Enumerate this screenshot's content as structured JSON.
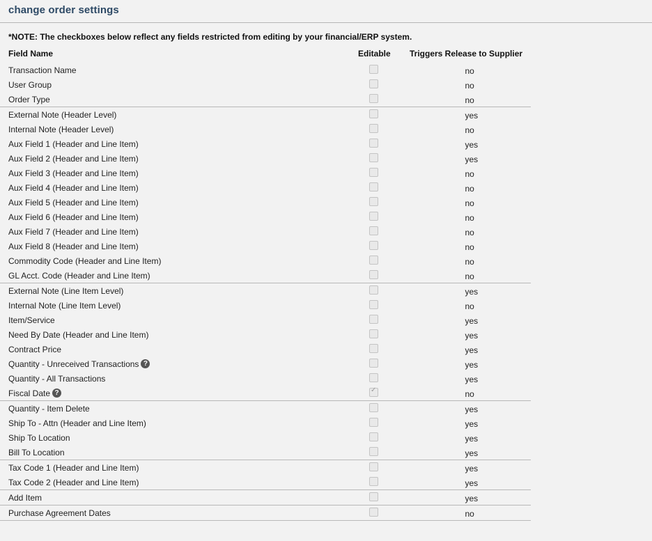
{
  "page": {
    "title": "change order settings",
    "note": "*NOTE: The checkboxes below reflect any fields restricted from editing by your financial/ERP system."
  },
  "table": {
    "headers": {
      "field_name": "Field Name",
      "editable": "Editable",
      "triggers": "Triggers Release to Supplier"
    },
    "rows": [
      {
        "name": "Transaction Name",
        "editable": false,
        "triggers": "no",
        "sep": false,
        "help": false
      },
      {
        "name": "User Group",
        "editable": false,
        "triggers": "no",
        "sep": false,
        "help": false
      },
      {
        "name": "Order Type",
        "editable": false,
        "triggers": "no",
        "sep": false,
        "help": false
      },
      {
        "name": "External Note (Header Level)",
        "editable": false,
        "triggers": "yes",
        "sep": true,
        "help": false
      },
      {
        "name": "Internal Note (Header Level)",
        "editable": false,
        "triggers": "no",
        "sep": false,
        "help": false
      },
      {
        "name": "Aux Field 1 (Header and Line Item)",
        "editable": false,
        "triggers": "yes",
        "sep": false,
        "help": false
      },
      {
        "name": "Aux Field 2 (Header and Line Item)",
        "editable": false,
        "triggers": "yes",
        "sep": false,
        "help": false
      },
      {
        "name": "Aux Field 3 (Header and Line Item)",
        "editable": false,
        "triggers": "no",
        "sep": false,
        "help": false
      },
      {
        "name": "Aux Field 4 (Header and Line Item)",
        "editable": false,
        "triggers": "no",
        "sep": false,
        "help": false
      },
      {
        "name": "Aux Field 5 (Header and Line Item)",
        "editable": false,
        "triggers": "no",
        "sep": false,
        "help": false
      },
      {
        "name": "Aux Field 6 (Header and Line Item)",
        "editable": false,
        "triggers": "no",
        "sep": false,
        "help": false
      },
      {
        "name": "Aux Field 7 (Header and Line Item)",
        "editable": false,
        "triggers": "no",
        "sep": false,
        "help": false
      },
      {
        "name": "Aux Field 8 (Header and Line Item)",
        "editable": false,
        "triggers": "no",
        "sep": false,
        "help": false
      },
      {
        "name": "Commodity Code (Header and Line Item)",
        "editable": false,
        "triggers": "no",
        "sep": false,
        "help": false
      },
      {
        "name": "GL Acct. Code (Header and Line Item)",
        "editable": false,
        "triggers": "no",
        "sep": false,
        "help": false
      },
      {
        "name": "External Note (Line Item Level)",
        "editable": false,
        "triggers": "yes",
        "sep": true,
        "help": false
      },
      {
        "name": "Internal Note (Line Item Level)",
        "editable": false,
        "triggers": "no",
        "sep": false,
        "help": false
      },
      {
        "name": "Item/Service",
        "editable": false,
        "triggers": "yes",
        "sep": false,
        "help": false
      },
      {
        "name": "Need By Date (Header and Line Item)",
        "editable": false,
        "triggers": "yes",
        "sep": false,
        "help": false
      },
      {
        "name": "Contract Price",
        "editable": false,
        "triggers": "yes",
        "sep": false,
        "help": false
      },
      {
        "name": "Quantity - Unreceived Transactions",
        "editable": false,
        "triggers": "yes",
        "sep": false,
        "help": true
      },
      {
        "name": "Quantity - All Transactions",
        "editable": false,
        "triggers": "yes",
        "sep": false,
        "help": false
      },
      {
        "name": "Fiscal Date",
        "editable": true,
        "triggers": "no",
        "sep": false,
        "help": true
      },
      {
        "name": "Quantity - Item Delete",
        "editable": false,
        "triggers": "yes",
        "sep": true,
        "help": false
      },
      {
        "name": "Ship To - Attn (Header and Line Item)",
        "editable": false,
        "triggers": "yes",
        "sep": false,
        "help": false
      },
      {
        "name": "Ship To Location",
        "editable": false,
        "triggers": "yes",
        "sep": false,
        "help": false
      },
      {
        "name": "Bill To Location",
        "editable": false,
        "triggers": "yes",
        "sep": false,
        "help": false
      },
      {
        "name": "Tax Code 1 (Header and Line Item)",
        "editable": false,
        "triggers": "yes",
        "sep": true,
        "help": false
      },
      {
        "name": "Tax Code 2 (Header and Line Item)",
        "editable": false,
        "triggers": "yes",
        "sep": false,
        "help": false
      },
      {
        "name": "Add Item",
        "editable": false,
        "triggers": "yes",
        "sep": true,
        "help": false
      },
      {
        "name": "Purchase Agreement Dates",
        "editable": false,
        "triggers": "no",
        "sep": true,
        "help": false
      }
    ]
  },
  "icons": {
    "help": "question-circle-icon",
    "help_glyph": "?"
  }
}
